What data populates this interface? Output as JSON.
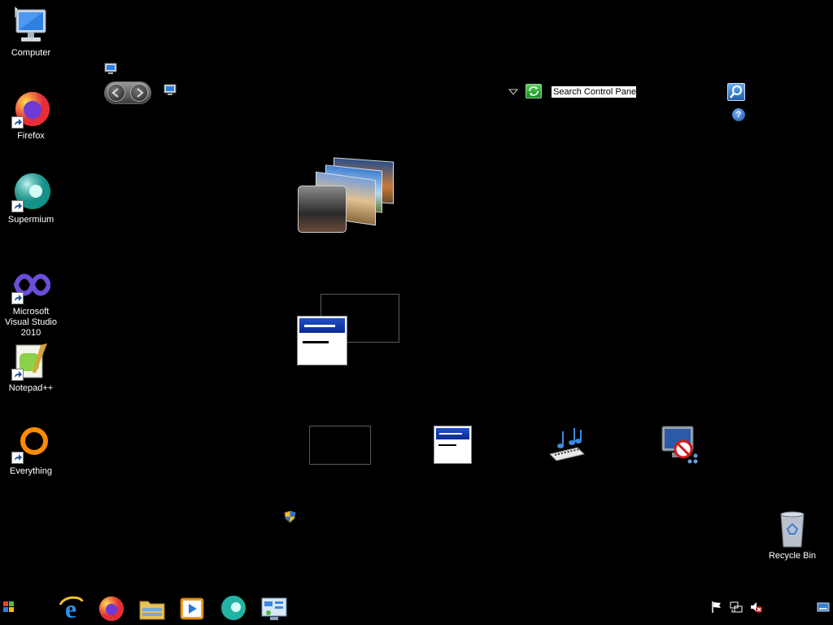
{
  "desktop": {
    "icons": [
      {
        "label": "Computer",
        "icon": "computer-icon"
      },
      {
        "label": "Firefox",
        "icon": "firefox-icon"
      },
      {
        "label": "Supermium",
        "icon": "supermium-icon"
      },
      {
        "label": "Microsoft Visual Studio 2010",
        "icon": "visual-studio-icon"
      },
      {
        "label": "Notepad++",
        "icon": "notepadpp-icon"
      },
      {
        "label": "Everything",
        "icon": "everything-icon"
      },
      {
        "label": "Recycle Bin",
        "icon": "recycle-bin-icon"
      }
    ]
  },
  "control_panel": {
    "search_placeholder": "Search Control Panel",
    "help_label": "?"
  },
  "taskbar": {
    "start": "start-button",
    "pinned": [
      "internet-explorer-icon",
      "firefox-icon",
      "file-explorer-icon",
      "media-player-icon",
      "supermium-icon",
      "control-panel-icon"
    ],
    "tray": [
      "action-center-flag-icon",
      "network-icon",
      "volume-muted-icon",
      "show-desktop-icon"
    ]
  },
  "colors": {
    "background": "#000000",
    "accent_blue": "#1f50c8"
  }
}
